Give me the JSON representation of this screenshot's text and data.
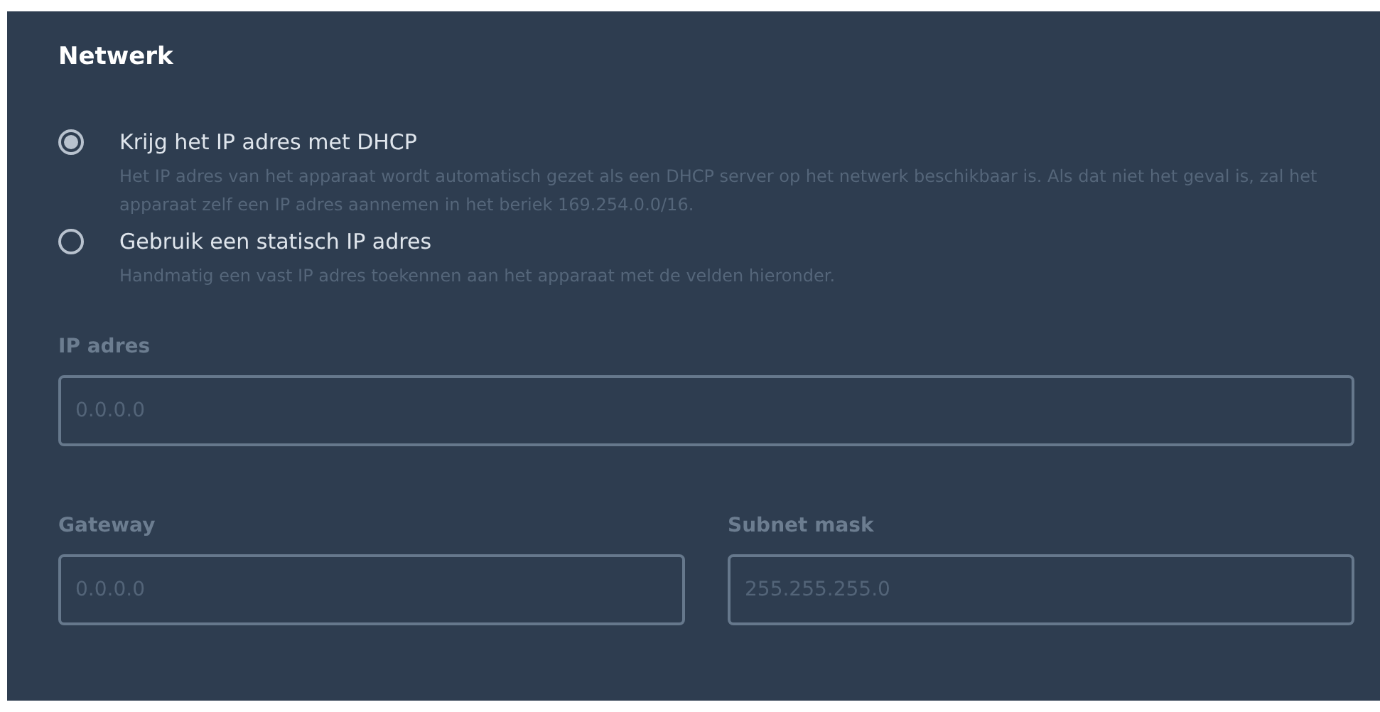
{
  "section": {
    "title": "Netwerk"
  },
  "options": [
    {
      "label": "Krijg het IP adres met DHCP",
      "description": "Het IP adres van het apparaat wordt automatisch gezet als een DHCP server op het netwerk beschikbaar is. Als dat niet het geval is, zal het apparaat zelf een IP adres aannemen in het beriek 169.254.0.0/16.",
      "selected": true
    },
    {
      "label": "Gebruik een statisch IP adres",
      "description": "Handmatig een vast IP adres toekennen aan het apparaat met de velden hieronder.",
      "selected": false
    }
  ],
  "fields": [
    {
      "label": "IP adres",
      "placeholder": "0.0.0.0",
      "disabled": true
    },
    {
      "label": "Gateway",
      "placeholder": "0.0.0.0",
      "disabled": true
    },
    {
      "label": "Subnet mask",
      "placeholder": "255.255.255.0",
      "disabled": true
    }
  ]
}
